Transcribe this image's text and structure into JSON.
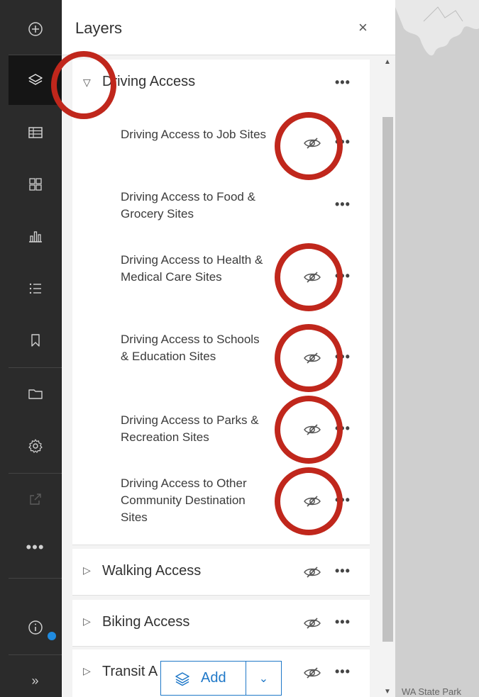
{
  "panel": {
    "title": "Layers",
    "close_label": "×"
  },
  "toolbar": {
    "items": [
      {
        "icon": "add-circle-icon"
      },
      {
        "icon": "layers-icon",
        "active": true
      },
      {
        "icon": "table-icon"
      },
      {
        "icon": "legend-icon"
      },
      {
        "icon": "chart-icon"
      },
      {
        "icon": "list-icon"
      },
      {
        "icon": "bookmark-icon"
      },
      {
        "icon": "folder-icon"
      },
      {
        "icon": "gear-icon"
      },
      {
        "icon": "share-icon",
        "disabled": true
      },
      {
        "icon": "more-icon"
      },
      {
        "icon": "info-icon"
      },
      {
        "icon": "expand-icon"
      }
    ],
    "more_label": "•••",
    "expand_label": "»"
  },
  "layers": {
    "driving": {
      "title": "Driving Access",
      "sublayers": [
        {
          "label": "Driving Access to Job Sites"
        },
        {
          "label": "Driving Access to Food & Grocery Sites"
        },
        {
          "label": "Driving Access to Health & Medical Care Sites"
        },
        {
          "label": "Driving Access to Schools & Education Sites"
        },
        {
          "label": "Driving Access to Parks & Recreation Sites"
        },
        {
          "label": "Driving Access to Other Community Destination Sites"
        }
      ]
    },
    "walking": {
      "title": "Walking Access"
    },
    "biking": {
      "title": "Biking Access"
    },
    "transit": {
      "title": "Transit A"
    }
  },
  "more_label": "•••",
  "add_button": {
    "label": "Add"
  },
  "map": {
    "label": "WA State Park"
  },
  "colors": {
    "accent": "#1f78c8",
    "annotation": "#c0271c",
    "toolbar_bg": "#2b2b2b"
  }
}
